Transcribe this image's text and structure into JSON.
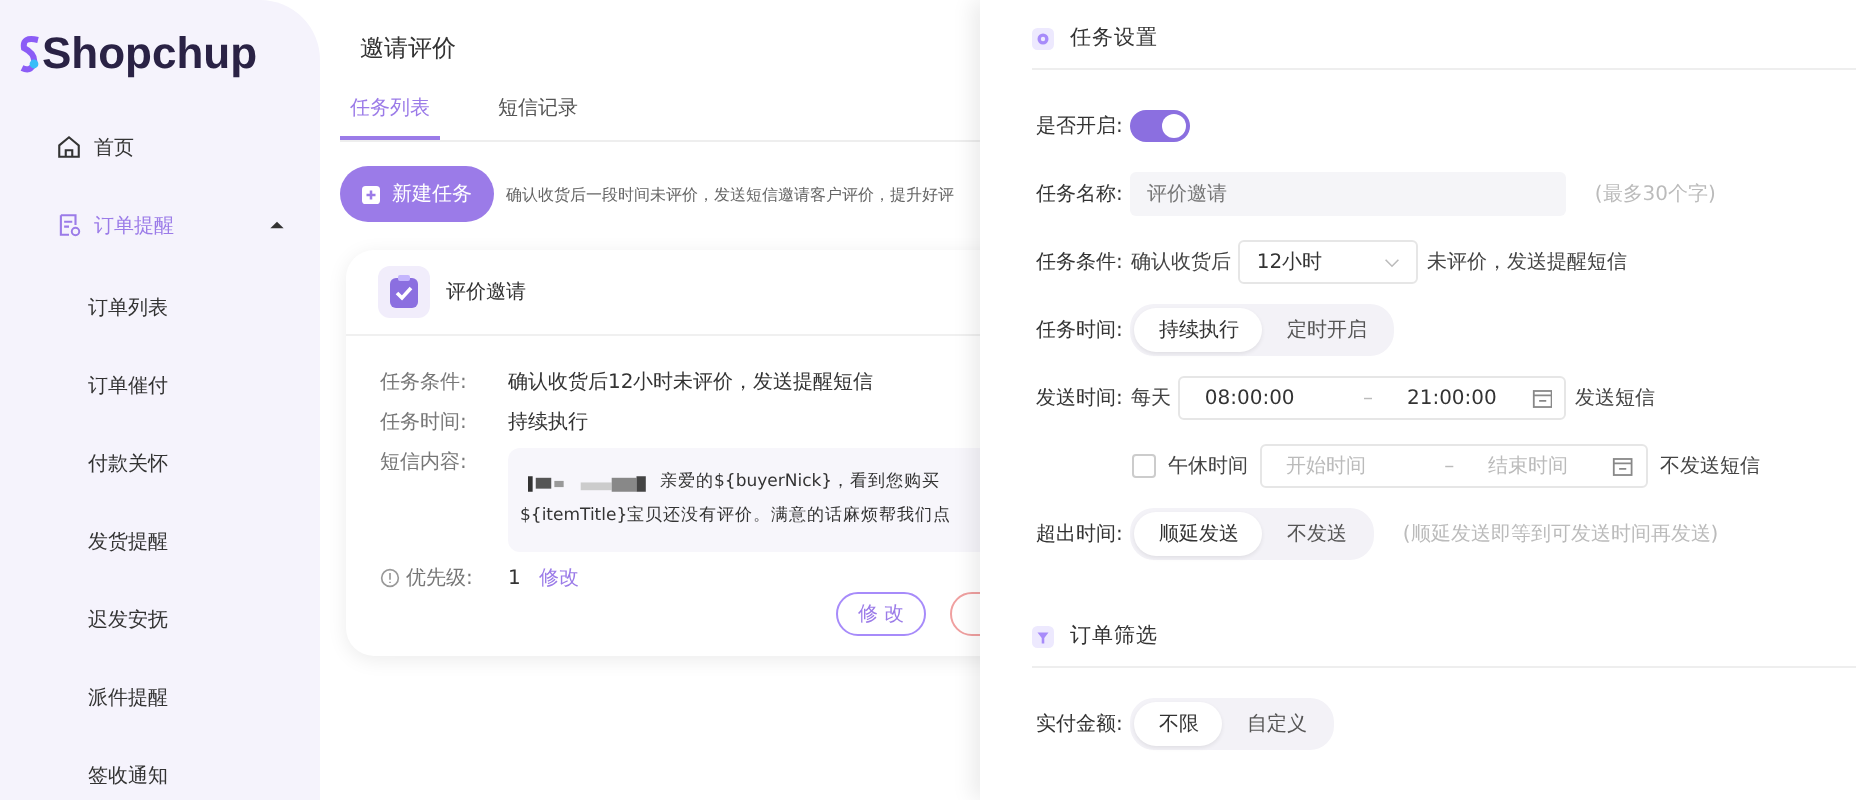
{
  "logo": "Shopchup",
  "sidebar": {
    "items": [
      {
        "label": "首页",
        "kind": "home",
        "selected": false
      },
      {
        "label": "订单提醒",
        "kind": "order",
        "expanded": true,
        "selected": true,
        "children": [
          {
            "label": "订单列表"
          },
          {
            "label": "订单催付"
          },
          {
            "label": "付款关怀"
          },
          {
            "label": "发货提醒"
          },
          {
            "label": "迟发安抚"
          },
          {
            "label": "派件提醒"
          },
          {
            "label": "签收通知"
          }
        ]
      }
    ]
  },
  "page": {
    "title": "邀请评价",
    "tabs": [
      {
        "label": "任务列表",
        "selected": true
      },
      {
        "label": "短信记录",
        "selected": false
      }
    ],
    "new_button": "新建任务",
    "hint": "确认收货后一段时间未评价，发送短信邀请客户评价，提升好评",
    "task_card": {
      "title": "评价邀请",
      "fields": [
        {
          "label": "任务条件:",
          "value": "确认收货后12小时未评价，发送提醒短信"
        },
        {
          "label": "任务时间:",
          "value": "持续执行"
        }
      ],
      "sms_label": "短信内容:",
      "sms_lines": [
        "亲爱的${buyerNick}，看到您购买",
        "${itemTitle}宝贝还没有评价。满意的话麻烦帮我们点"
      ],
      "priority_label": "优先级:",
      "priority": "1",
      "priority_edit": "修改",
      "edit_button": "修 改"
    }
  },
  "drawer": {
    "settings_title": "任务设置",
    "enable_label": "是否开启:",
    "enabled": true,
    "name_label": "任务名称:",
    "name_value": "评价邀请",
    "name_note": "(最多30个字)",
    "condition_label": "任务条件:",
    "condition_prefix": "确认收货后",
    "condition_select": "12小时",
    "condition_suffix": "未评价，发送提醒短信",
    "time_label": "任务时间:",
    "time_options": [
      {
        "label": "持续执行",
        "selected": true
      },
      {
        "label": "定时开启",
        "selected": false
      }
    ],
    "range_separator": "–",
    "send_label": "发送时间:",
    "send_prefix": "每天",
    "send_start": "08:00:00",
    "send_end": "21:00:00",
    "send_suffix": "发送短信",
    "lunch_checked": false,
    "lunch_label": "午休时间",
    "lunch_start_placeholder": "开始时间",
    "lunch_end_placeholder": "结束时间",
    "lunch_suffix": "不发送短信",
    "overflow_label": "超出时间:",
    "overflow_options": [
      {
        "label": "顺延发送",
        "selected": true
      },
      {
        "label": "不发送",
        "selected": false
      }
    ],
    "overflow_note": "(顺延发送即等到可发送时间再发送)",
    "filter_title": "订单筛选",
    "amount_label": "实付金额:",
    "amount_options": [
      {
        "label": "不限",
        "selected": true
      },
      {
        "label": "自定义",
        "selected": false
      }
    ]
  }
}
